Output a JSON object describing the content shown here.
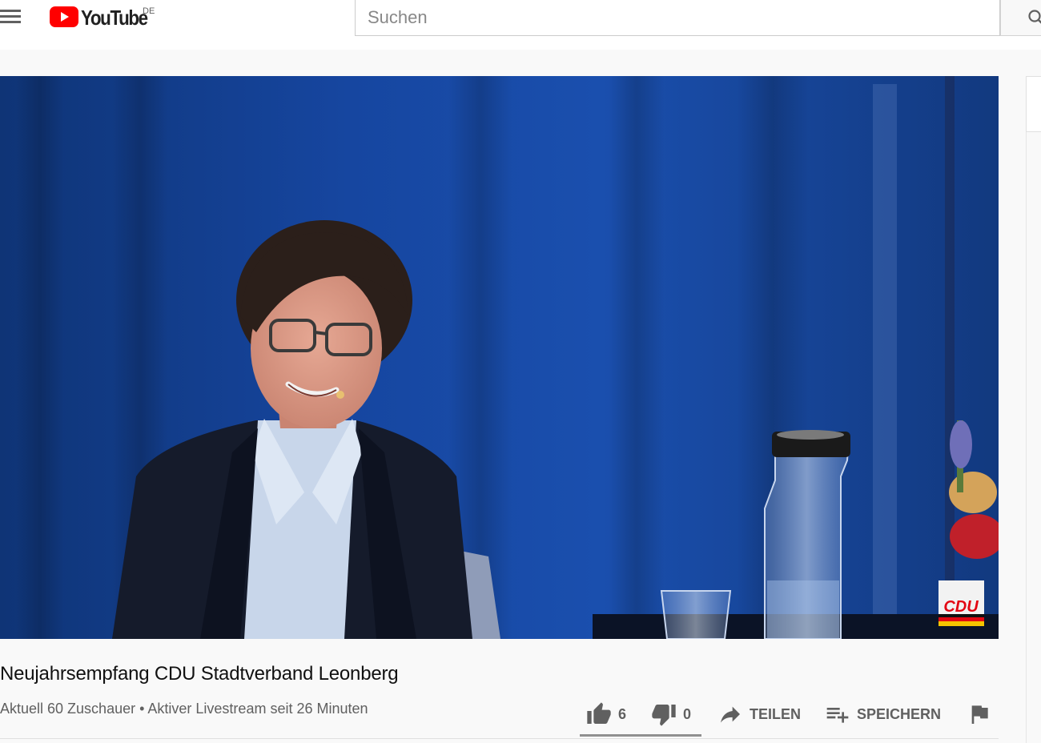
{
  "masthead": {
    "logo_text": "YouTube",
    "region": "DE",
    "search_placeholder": "Suchen"
  },
  "video": {
    "overlay_logo_text": "CDU",
    "title": "Neujahrsempfang CDU Stadtverband Leonberg",
    "info": "Aktuell 60 Zuschauer • Aktiver Livestream seit 26 Minuten"
  },
  "actions": {
    "like_count": "6",
    "dislike_count": "0",
    "share_label": "TEILEN",
    "save_label": "SPEICHERN",
    "like_ratio": 1.0
  },
  "colors": {
    "brand_red": "#ff0000",
    "icon_grey": "#606060",
    "text_primary": "#111111",
    "text_secondary": "#606060"
  },
  "icons": [
    "menu-icon",
    "youtube-logo-icon",
    "search-icon",
    "thumbs-up-icon",
    "thumbs-down-icon",
    "share-icon",
    "playlist-add-icon",
    "flag-icon"
  ]
}
